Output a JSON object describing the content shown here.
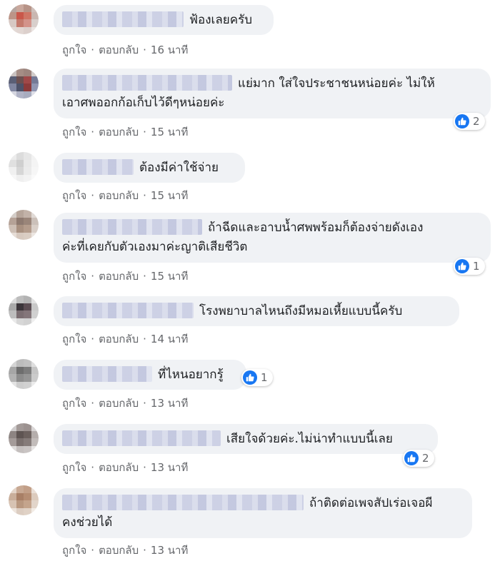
{
  "labels": {
    "like": "ถูกใจ",
    "reply": "ตอบกลับ",
    "separator": "·"
  },
  "colors": {
    "bubble": "#f0f2f5",
    "link": "#65676b",
    "like_blue": "#1877f2"
  },
  "comments": [
    {
      "text": "ฟ้องเลยครับ",
      "time": "16 นาที"
    },
    {
      "text_line1": "แย่มาก ใส่ใจประชาชนหน่อยค่ะ ไม่ให้",
      "text_line2": "เอาศพออกก้อเก็บไว้ดีๆหน่อยค่ะ",
      "time": "15 นาที",
      "likes": "2"
    },
    {
      "text": "ต้องมีค่าใช้จ่าย",
      "time": "15 นาที"
    },
    {
      "text_line1": "ถ้าฉีดและอาบน้ำศพพร้อมก็ต้องจ่ายดังเอง",
      "text_line2": "ค่ะที่เคยกับตัวเองมาค่ะญาติเสียชีวิต",
      "time": "15 นาที",
      "likes": "1"
    },
    {
      "text": "โรงพยาบาลไหนถึงมีหมอเหี้ยแบบนี้ครับ",
      "time": "14 นาที"
    },
    {
      "text": "ที่ไหนอยากรู้",
      "time": "13 นาที",
      "likes": "1"
    },
    {
      "text": "เสียใจด้วยค่ะ.ไม่น่าทำแบบนี้เลย",
      "time": "13 นาที",
      "likes": "2"
    },
    {
      "text_line1": "ถ้าติดต่อเพจสัปเร่อเจอผี",
      "text_line2": "คงช่วยได้",
      "time": "13 นาที"
    }
  ]
}
